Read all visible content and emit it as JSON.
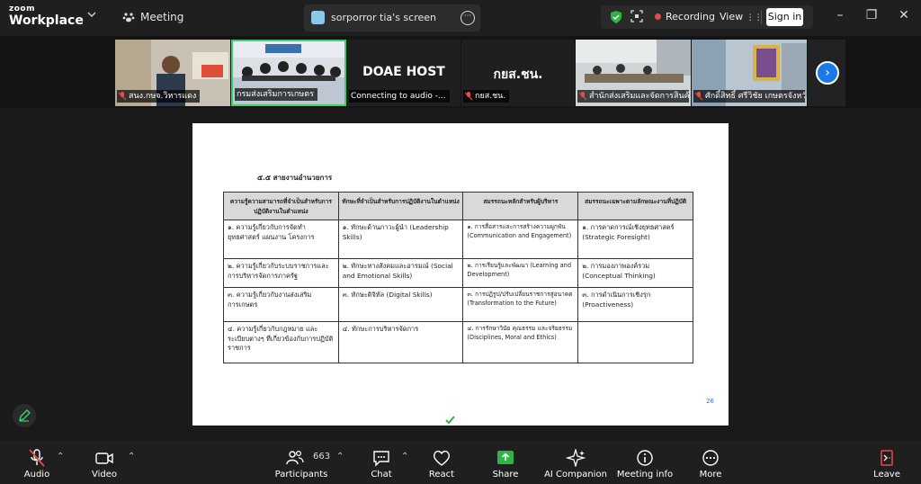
{
  "app": {
    "logo_line1": "zoom",
    "logo_line2": "Workplace",
    "meeting_label": "Meeting"
  },
  "share_tab": {
    "title": "sorporror tia's screen"
  },
  "status": {
    "recording_label": "Recording",
    "view_label": "View",
    "signin_label": "Sign in"
  },
  "participants_strip": [
    {
      "name": "สนง.กษจ.วิหารแดง"
    },
    {
      "name": "กรมส่งเสริมการเกษตร"
    },
    {
      "name": "Connecting to audio -...",
      "title": "DOAE HOST"
    },
    {
      "name": "กยส.ชน.",
      "title": "กยส.ชน."
    },
    {
      "name": "สำนักส่งเสริมและจัดการสินค้า"
    },
    {
      "name": "ศักดิ์สิทธิ์ ศรีวิชัย เกษตรจังหวัด"
    }
  ],
  "slide": {
    "heading": "๕.๕ สายงานอำนวยการ",
    "table": {
      "headers": [
        "ความรู้ความสามารถที่จำเป็นสำหรับการปฏิบัติงานในตำแหน่ง",
        "ทักษะที่จำเป็นสำหรับการปฏิบัติงานในตำแหน่ง",
        "สมรรถนะหลักสำหรับผู้บริหาร",
        "สมรรถนะเฉพาะตามลักษณะงานที่ปฏิบัติ"
      ],
      "rows": [
        [
          "๑. ความรู้เกี่ยวกับการจัดทำยุทธศาสตร์ แผนงาน โครงการ",
          "๑. ทักษะด้านภาวะผู้นำ (Leadership Skills)",
          "๑. การสื่อสารและการสร้างความผูกพัน (Communication and Engagement)",
          "๑. การคาดการณ์เชิงยุทธศาสตร์ (Strategic Foresight)"
        ],
        [
          "๒. ความรู้เกี่ยวกับระบบราชการและการบริหารจัดการภาครัฐ",
          "๒. ทักษะทางสังคมและอารมณ์ (Social and Emotional Skills)",
          "๒. การเรียนรู้และพัฒนา (Learning and Development)",
          "๒. การมองภาพองค์รวม (Conceptual Thinking)"
        ],
        [
          "๓. ความรู้เกี่ยวกับงานส่งเสริมการเกษตร",
          "๓. ทักษะดิจิทัล (Digital Skills)",
          "๓. การปฏิรูป/ปรับเปลี่ยนราชการสู่อนาคต (Transformation to the Future)",
          "๓. การดำเนินการเชิงรุก (Proactiveness)"
        ],
        [
          "๔. ความรู้เกี่ยวกับกฎหมาย และระเบียบต่างๆ ที่เกี่ยวข้องกับการปฏิบัติราชการ",
          "๔. ทักษะการบริหารจัดการ",
          "๔. การรักษาวินัย คุณธรรม และจริยธรรม (Disciplines, Moral and Ethics)",
          ""
        ]
      ]
    },
    "page_number": "26"
  },
  "toolbar": {
    "audio": "Audio",
    "video": "Video",
    "participants": "Participants",
    "participants_count": "663",
    "chat": "Chat",
    "react": "React",
    "share": "Share",
    "ai_companion": "AI Companion",
    "meeting_info": "Meeting info",
    "more": "More",
    "leave": "Leave"
  },
  "colors": {
    "accent_green": "#3bd16f",
    "share_green": "#2fb344",
    "next_blue": "#1a78e8",
    "recording_red": "#e84a4a"
  }
}
